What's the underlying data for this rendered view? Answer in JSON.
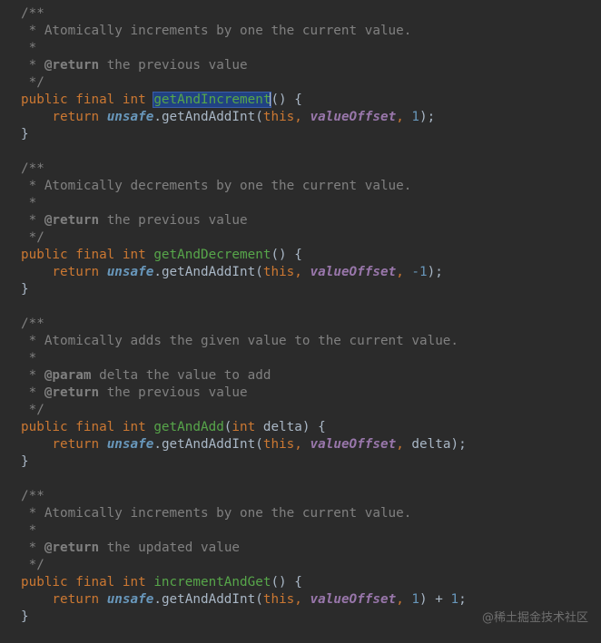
{
  "syntax_colors": {
    "background": "#2b2b2b",
    "comment": "#808080",
    "keyword": "#cc7832",
    "method_name": "#57a64a",
    "field": "#9876aa",
    "number": "#6897bb",
    "default_text": "#a9b7c6",
    "selection": "#214283"
  },
  "selected_identifier": "getAndIncrement",
  "code_lines": [
    [
      {
        "t": "/**",
        "c": "comment"
      }
    ],
    [
      {
        "t": " * Atomically increments by one the current value.",
        "c": "comment"
      }
    ],
    [
      {
        "t": " *",
        "c": "comment"
      }
    ],
    [
      {
        "t": " * ",
        "c": "comment"
      },
      {
        "t": "@return",
        "c": "tag"
      },
      {
        "t": " the previous value",
        "c": "comment"
      }
    ],
    [
      {
        "t": " */",
        "c": "comment"
      }
    ],
    [
      {
        "t": "public final int ",
        "c": "kw"
      },
      {
        "t": "getAndIncrement",
        "c": "fn-sel"
      },
      {
        "t": "CARET",
        "c": "caret"
      },
      {
        "t": "() {",
        "c": "paren"
      }
    ],
    [
      {
        "t": "    return ",
        "c": "kw"
      },
      {
        "t": "unsafe",
        "c": "unsafe"
      },
      {
        "t": ".getAndAddInt(",
        "c": "plain"
      },
      {
        "t": "this",
        "c": "kw"
      },
      {
        "t": ", ",
        "c": "punc"
      },
      {
        "t": "valueOffset",
        "c": "field"
      },
      {
        "t": ", ",
        "c": "punc"
      },
      {
        "t": "1",
        "c": "num"
      },
      {
        "t": ");",
        "c": "plain"
      }
    ],
    [
      {
        "t": "}",
        "c": "plain"
      }
    ],
    [
      {
        "t": "",
        "c": "plain"
      }
    ],
    [
      {
        "t": "/**",
        "c": "comment"
      }
    ],
    [
      {
        "t": " * Atomically decrements by one the current value.",
        "c": "comment"
      }
    ],
    [
      {
        "t": " *",
        "c": "comment"
      }
    ],
    [
      {
        "t": " * ",
        "c": "comment"
      },
      {
        "t": "@return",
        "c": "tag"
      },
      {
        "t": " the previous value",
        "c": "comment"
      }
    ],
    [
      {
        "t": " */",
        "c": "comment"
      }
    ],
    [
      {
        "t": "public final int ",
        "c": "kw"
      },
      {
        "t": "getAndDecrement",
        "c": "fn"
      },
      {
        "t": "() {",
        "c": "paren"
      }
    ],
    [
      {
        "t": "    return ",
        "c": "kw"
      },
      {
        "t": "unsafe",
        "c": "unsafe"
      },
      {
        "t": ".getAndAddInt(",
        "c": "plain"
      },
      {
        "t": "this",
        "c": "kw"
      },
      {
        "t": ", ",
        "c": "punc"
      },
      {
        "t": "valueOffset",
        "c": "field"
      },
      {
        "t": ", ",
        "c": "punc"
      },
      {
        "t": "-1",
        "c": "num"
      },
      {
        "t": ");",
        "c": "plain"
      }
    ],
    [
      {
        "t": "}",
        "c": "plain"
      }
    ],
    [
      {
        "t": "",
        "c": "plain"
      }
    ],
    [
      {
        "t": "/**",
        "c": "comment"
      }
    ],
    [
      {
        "t": " * Atomically adds the given value to the current value.",
        "c": "comment"
      }
    ],
    [
      {
        "t": " *",
        "c": "comment"
      }
    ],
    [
      {
        "t": " * ",
        "c": "comment"
      },
      {
        "t": "@param",
        "c": "tag"
      },
      {
        "t": " delta the value to add",
        "c": "comment"
      }
    ],
    [
      {
        "t": " * ",
        "c": "comment"
      },
      {
        "t": "@return",
        "c": "tag"
      },
      {
        "t": " the previous value",
        "c": "comment"
      }
    ],
    [
      {
        "t": " */",
        "c": "comment"
      }
    ],
    [
      {
        "t": "public final int ",
        "c": "kw"
      },
      {
        "t": "getAndAdd",
        "c": "fn"
      },
      {
        "t": "(",
        "c": "paren"
      },
      {
        "t": "int ",
        "c": "kw"
      },
      {
        "t": "delta",
        "c": "param"
      },
      {
        "t": ") {",
        "c": "paren"
      }
    ],
    [
      {
        "t": "    return ",
        "c": "kw"
      },
      {
        "t": "unsafe",
        "c": "unsafe"
      },
      {
        "t": ".getAndAddInt(",
        "c": "plain"
      },
      {
        "t": "this",
        "c": "kw"
      },
      {
        "t": ", ",
        "c": "punc"
      },
      {
        "t": "valueOffset",
        "c": "field"
      },
      {
        "t": ", ",
        "c": "punc"
      },
      {
        "t": "delta",
        "c": "param"
      },
      {
        "t": ");",
        "c": "plain"
      }
    ],
    [
      {
        "t": "}",
        "c": "plain"
      }
    ],
    [
      {
        "t": "",
        "c": "plain"
      }
    ],
    [
      {
        "t": "/**",
        "c": "comment"
      }
    ],
    [
      {
        "t": " * Atomically increments by one the current value.",
        "c": "comment"
      }
    ],
    [
      {
        "t": " *",
        "c": "comment"
      }
    ],
    [
      {
        "t": " * ",
        "c": "comment"
      },
      {
        "t": "@return",
        "c": "tag"
      },
      {
        "t": " the updated value",
        "c": "comment"
      }
    ],
    [
      {
        "t": " */",
        "c": "comment"
      }
    ],
    [
      {
        "t": "public final int ",
        "c": "kw"
      },
      {
        "t": "incrementAndGet",
        "c": "fn"
      },
      {
        "t": "() {",
        "c": "paren"
      }
    ],
    [
      {
        "t": "    return ",
        "c": "kw"
      },
      {
        "t": "unsafe",
        "c": "unsafe"
      },
      {
        "t": ".getAndAddInt(",
        "c": "plain"
      },
      {
        "t": "this",
        "c": "kw"
      },
      {
        "t": ", ",
        "c": "punc"
      },
      {
        "t": "valueOffset",
        "c": "field"
      },
      {
        "t": ", ",
        "c": "punc"
      },
      {
        "t": "1",
        "c": "num"
      },
      {
        "t": ") + ",
        "c": "plain"
      },
      {
        "t": "1",
        "c": "num"
      },
      {
        "t": ";",
        "c": "plain"
      }
    ],
    [
      {
        "t": "}",
        "c": "plain"
      }
    ]
  ],
  "watermark": "@稀土掘金技术社区"
}
